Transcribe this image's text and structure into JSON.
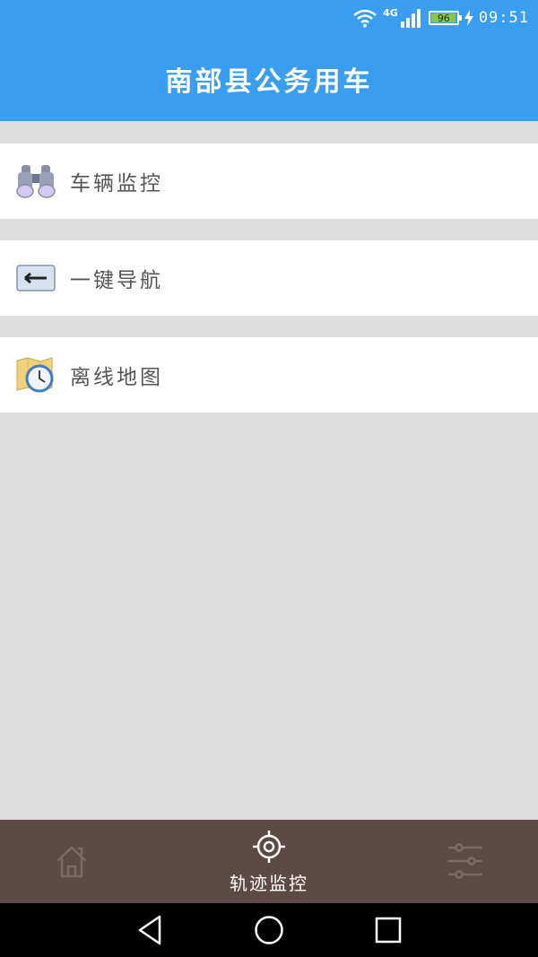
{
  "status_bar": {
    "network": "4G",
    "battery_level": 96,
    "battery_text": "96",
    "time": "09:51",
    "icons": [
      "wifi-icon",
      "signal-icon",
      "battery-icon",
      "charging-icon"
    ]
  },
  "header": {
    "title": "南部县公务用车"
  },
  "menu": {
    "items": [
      {
        "label": "车辆监控",
        "icon": "binoculars-icon"
      },
      {
        "label": "一键导航",
        "icon": "back-arrow-icon"
      },
      {
        "label": "离线地图",
        "icon": "map-clock-icon"
      }
    ]
  },
  "bottom_nav": {
    "items": [
      {
        "label": "",
        "icon": "home-icon"
      },
      {
        "label": "轨迹监控",
        "icon": "target-icon"
      },
      {
        "label": "",
        "icon": "settings-sliders-icon"
      }
    ]
  },
  "colors": {
    "primary": "#3a9ef0",
    "bottom_nav": "#5d4a45",
    "background": "#dcdcdc"
  }
}
